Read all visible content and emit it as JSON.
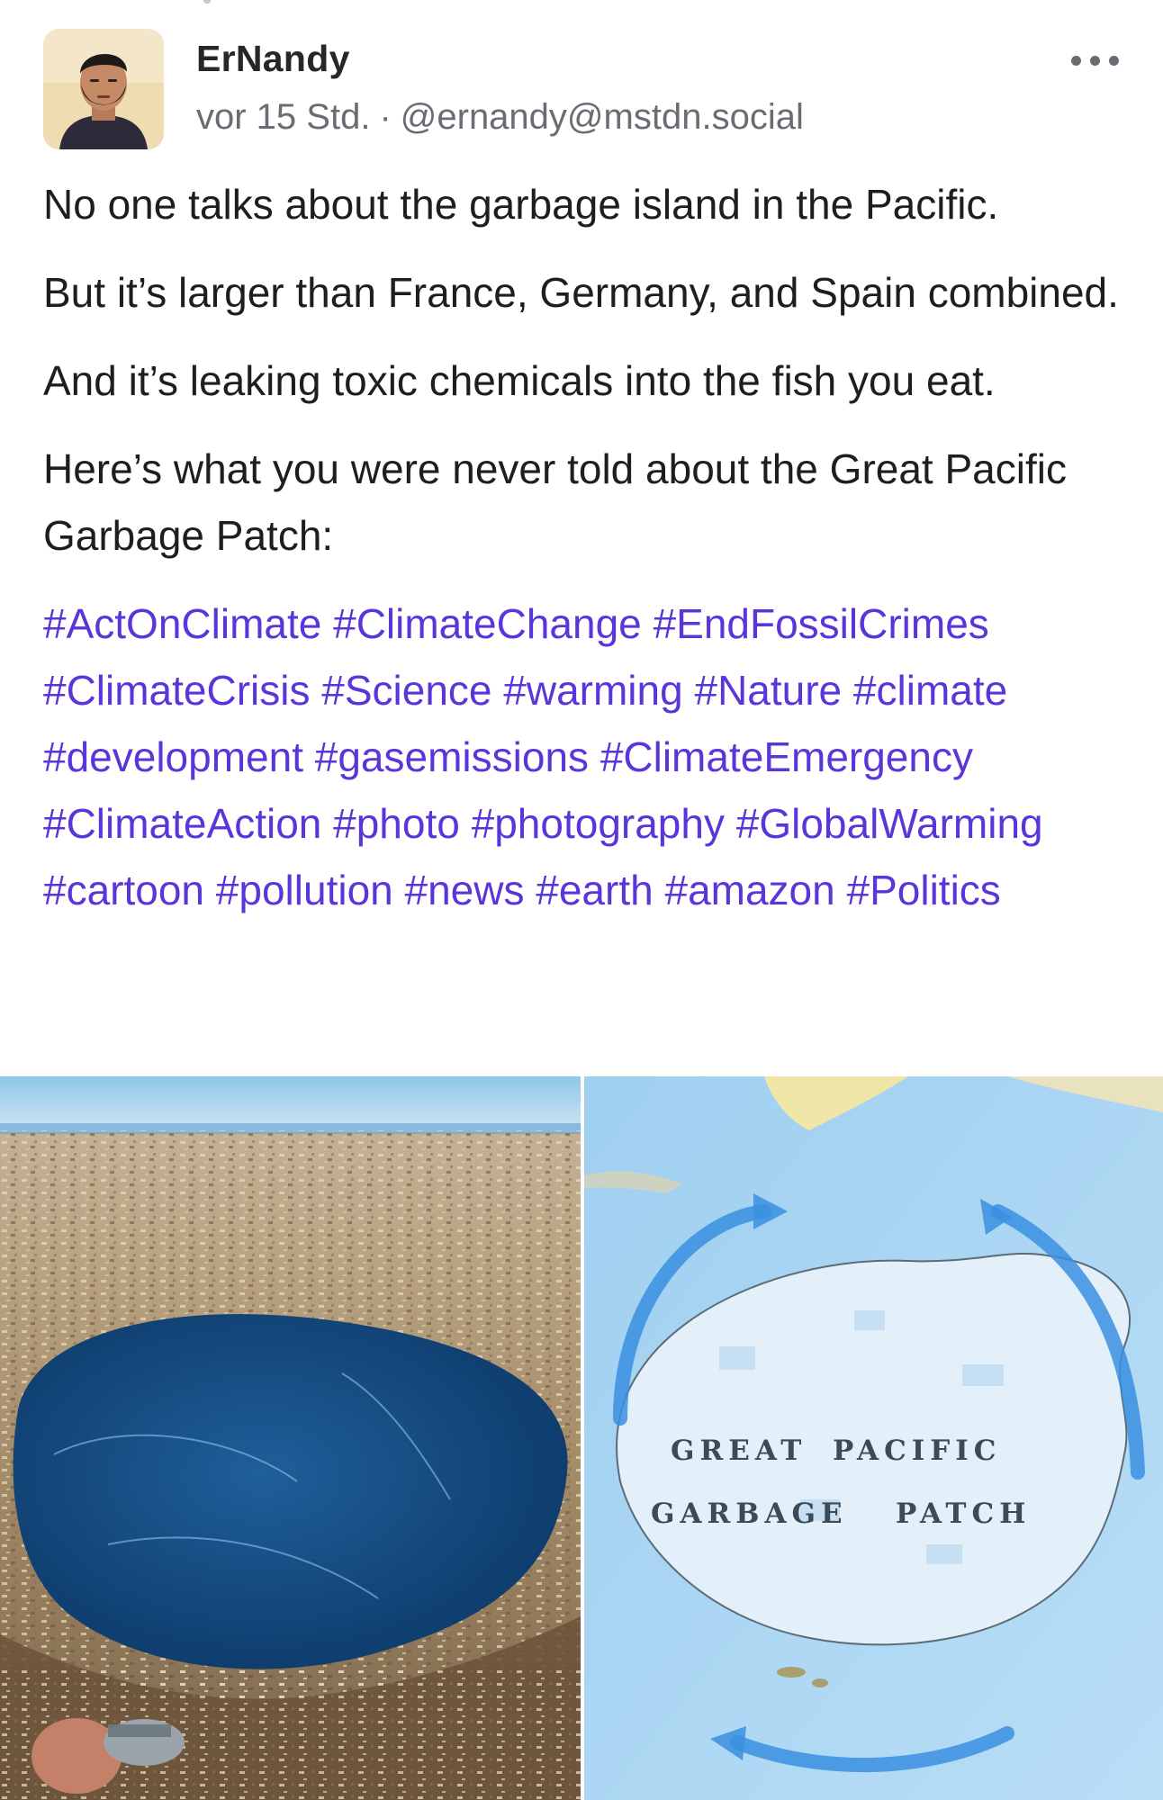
{
  "post": {
    "author": {
      "display_name": "ErNandy",
      "handle": "@ernandy@mstdn.social",
      "avatar": "avatar-man-beard"
    },
    "timestamp": "vor 15 Std.",
    "meta_separator": "·",
    "more_icon": "ellipsis-horizontal-icon",
    "paragraphs": [
      "No one talks about the garbage island in the Pacific.",
      "But it’s larger than France, Germany, and Spain combined.",
      "And it’s leaking toxic chemicals into the fish you eat.",
      "Here’s what you were never told about the Great Pacific Garbage Patch:"
    ],
    "hashtags": [
      "#ActOnClimate",
      "#ClimateChange",
      "#EndFossilCrimes",
      "#ClimateCrisis",
      "#Science",
      "#warming",
      "#Nature",
      "#climate",
      "#development",
      "#gasemissions",
      "#ClimateEmergency",
      "#ClimateAction",
      "#photo",
      "#photography",
      "#GlobalWarming",
      "#cartoon",
      "#pollution",
      "#news",
      "#earth",
      "#amazon",
      "#Politics"
    ],
    "media": {
      "map_label_line1_a": "GREAT",
      "map_label_line1_b": "PACIFIC",
      "map_label_line2_a": "GARBAGE",
      "map_label_line2_b": "PATCH"
    }
  },
  "colors": {
    "hashtag": "#5a35d9",
    "meta_text": "#6b6b73",
    "body_text": "#1d1d22",
    "ocean": "#a9d3f1"
  }
}
